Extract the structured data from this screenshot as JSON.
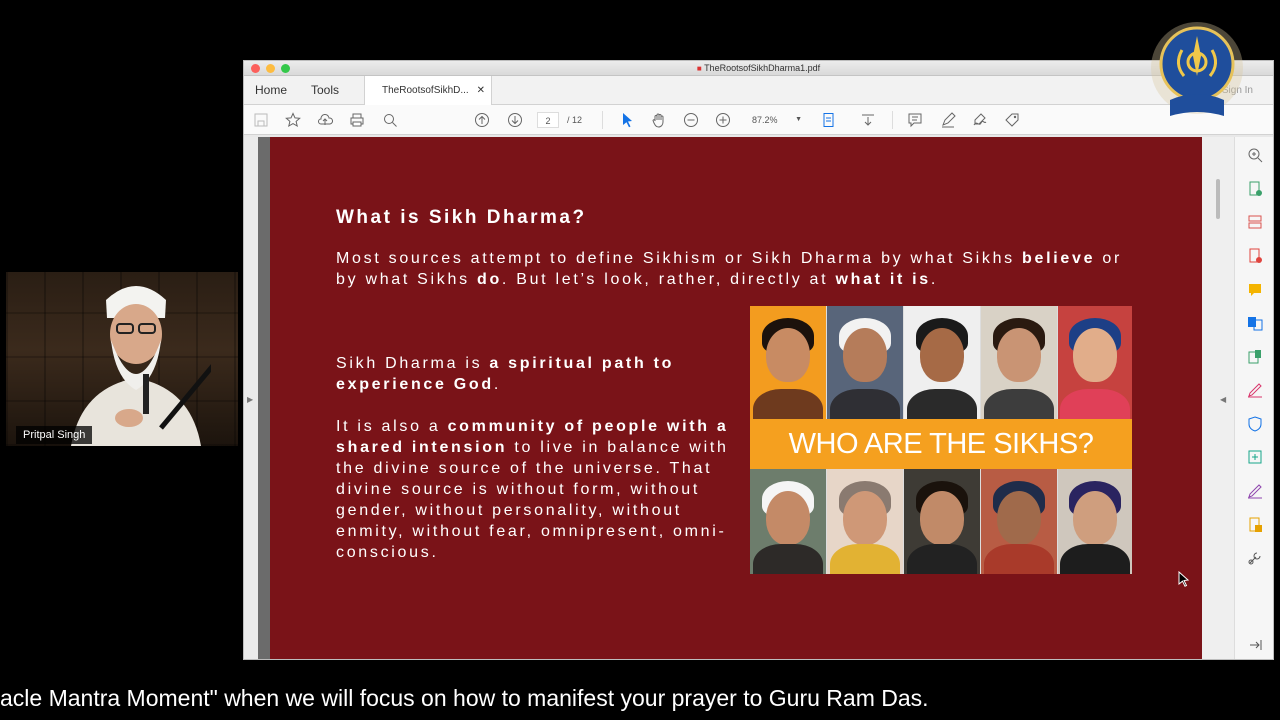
{
  "window": {
    "title": "TheRootsofSikhDharma1.pdf",
    "tabs": {
      "home": "Home",
      "tools": "Tools",
      "document": "TheRootsofSikhD...",
      "sign_in": "Sign In"
    },
    "toolbar": {
      "page_current": "2",
      "page_total": "/ 12",
      "zoom": "87.2%"
    }
  },
  "slide": {
    "title": "What is Sikh Dharma?",
    "para1_pre": "Most sources attempt to define Sikhism or Sikh Dharma by what Sikhs ",
    "para1_b1": "believe",
    "para1_mid": " or by what Sikhs ",
    "para1_b2": "do",
    "para1_mid2": ". But let’s look, rather, directly at ",
    "para1_b3": "what it is",
    "para1_end": ".",
    "para2_pre": "Sikh Dharma is ",
    "para2_b": "a spiritual path to experience God",
    "para2_end": ".",
    "para3_pre": "It is also a ",
    "para3_b": "community of people with a shared intension",
    "para3_end": " to live in balance with the divine source of the universe. That divine source is without form, without gender, without personality, without enmity, without fear, omnipresent, omni-conscious.",
    "banner": "WHO ARE THE SIKHS?"
  },
  "participant": {
    "name": "Pritpal Singh"
  },
  "caption": "acle Mantra Moment\" when we will focus on how to manifest your prayer to Guru Ram Das.",
  "colors": {
    "slide_bg": "#7a1318",
    "banner": "#f5a01f",
    "acrobat_accent": "#1473e6"
  }
}
